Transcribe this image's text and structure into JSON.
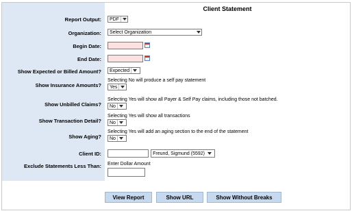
{
  "title": "Client Statement",
  "fields": {
    "report_output": {
      "label": "Report Output:",
      "value": "PDF"
    },
    "organization": {
      "label": "Organization:",
      "value": "Select Organization"
    },
    "begin_date": {
      "label": "Begin Date:"
    },
    "end_date": {
      "label": "End Date:"
    },
    "expected_or_billed": {
      "label": "Show Expected or Billed Amount?",
      "value": "Expected"
    },
    "insurance_amounts": {
      "label": "Show Insurance Amounts?",
      "note": "Selecting No will produce a self pay statement",
      "value": "Yes"
    },
    "unbilled_claims": {
      "label": "Show Unbilled Claims?",
      "note": "Selecting Yes will show all Payer & Self Pay claims, including those not batched.",
      "value": "No"
    },
    "transaction_detail": {
      "label": "Show Transaction Detail?",
      "note": "Selecting Yes will show all transactions",
      "value": "No"
    },
    "aging": {
      "label": "Show Aging?",
      "note": "Selecting Yes will add an aging section to the end of the statement",
      "value": "No"
    },
    "client_id": {
      "label": "Client ID:",
      "value": "Freund, Sigmund (5592)"
    },
    "exclude_less_than": {
      "label": "Exclude Statements Less Than:",
      "note": "Enter Dollar Amount"
    }
  },
  "buttons": {
    "view_report": "View Report",
    "show_url": "Show URL",
    "show_without_breaks": "Show Without Breaks"
  },
  "colors": {
    "label_bg": "#dde8f4",
    "button_bg": "#c7d9ee",
    "date_bg": "#fde0e0"
  }
}
